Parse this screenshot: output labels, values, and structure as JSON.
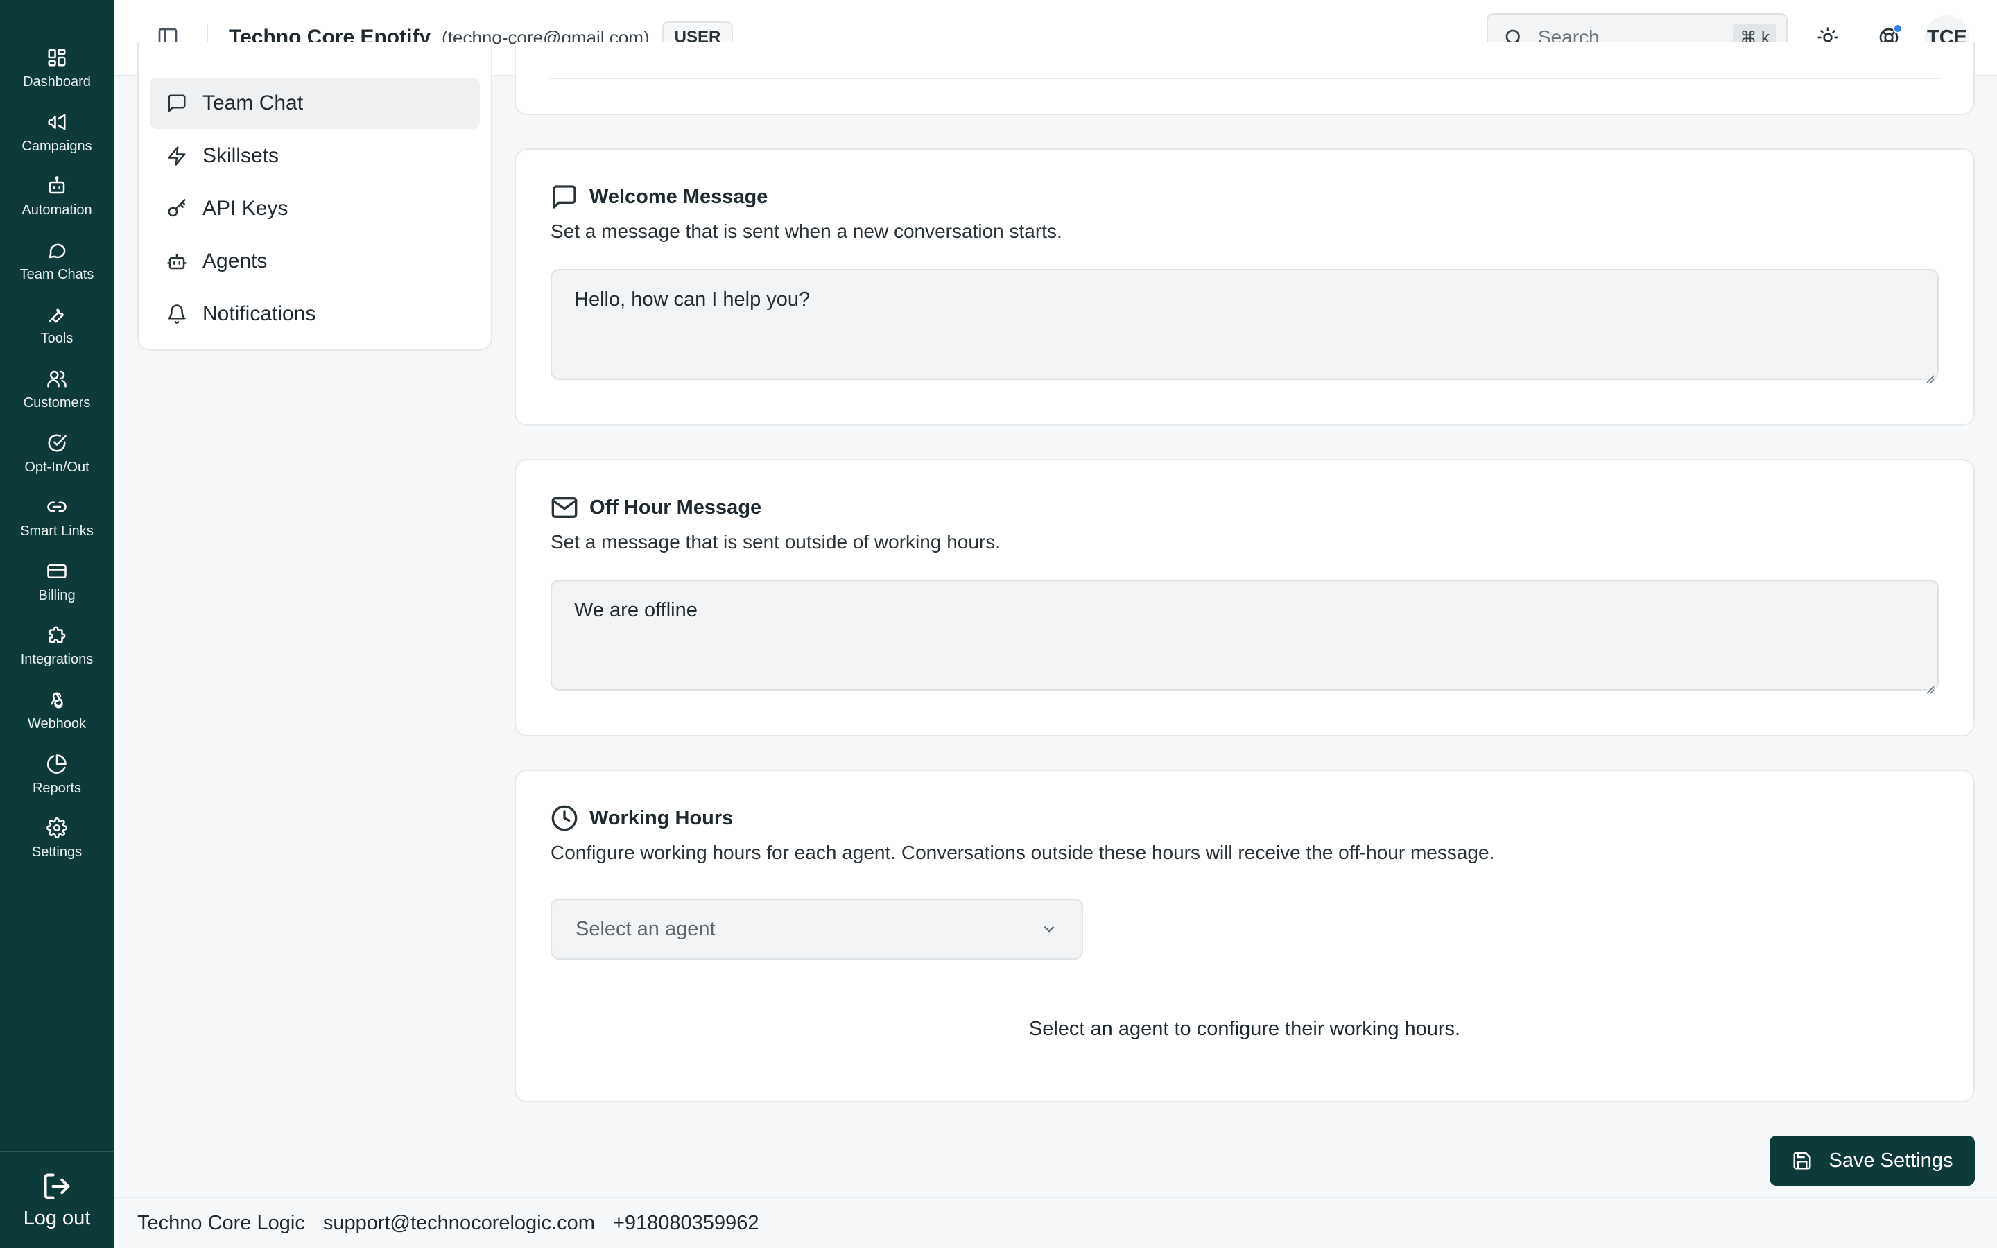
{
  "rail": {
    "items": [
      {
        "label": "Dashboard",
        "icon": "dashboard-icon"
      },
      {
        "label": "Campaigns",
        "icon": "megaphone-icon"
      },
      {
        "label": "Automation",
        "icon": "bot-icon"
      },
      {
        "label": "Team Chats",
        "icon": "chat-icon"
      },
      {
        "label": "Tools",
        "icon": "wrench-icon"
      },
      {
        "label": "Customers",
        "icon": "users-icon"
      },
      {
        "label": "Opt-In/Out",
        "icon": "check-circle-icon"
      },
      {
        "label": "Smart Links",
        "icon": "link-icon"
      },
      {
        "label": "Billing",
        "icon": "credit-card-icon"
      },
      {
        "label": "Integrations",
        "icon": "puzzle-icon"
      },
      {
        "label": "Webhook",
        "icon": "webhook-icon"
      },
      {
        "label": "Reports",
        "icon": "pie-chart-icon"
      },
      {
        "label": "Settings",
        "icon": "gear-icon"
      }
    ],
    "logout_label": "Log out"
  },
  "header": {
    "org_name": "Techno Core Enotify",
    "org_email": "(techno-core@gmail.com)",
    "role": "USER",
    "search_placeholder": "Search...",
    "search_shortcut": "⌘ k",
    "avatar_initials": "TCE"
  },
  "settings_menu": {
    "items": [
      {
        "label": "Team Chat",
        "icon": "message-square-icon",
        "active": true
      },
      {
        "label": "Skillsets",
        "icon": "lightning-icon",
        "active": false
      },
      {
        "label": "API Keys",
        "icon": "key-icon",
        "active": false
      },
      {
        "label": "Agents",
        "icon": "bot-icon",
        "active": false
      },
      {
        "label": "Notifications",
        "icon": "bell-icon",
        "active": false
      }
    ]
  },
  "welcome": {
    "title": "Welcome Message",
    "description": "Set a message that is sent when a new conversation starts.",
    "value": "Hello, how can I help you?"
  },
  "offhour": {
    "title": "Off Hour Message",
    "description": "Set a message that is sent outside of working hours.",
    "value": "We are offline"
  },
  "working_hours": {
    "title": "Working Hours",
    "description": "Configure working hours for each agent. Conversations outside these hours will receive the off-hour message.",
    "select_placeholder": "Select an agent",
    "hint": "Select an agent to configure their working hours."
  },
  "save_label": "Save Settings",
  "footer": {
    "company": "Techno Core Logic",
    "email": "support@technocorelogic.com",
    "phone": "+918080359962"
  },
  "colors": {
    "rail_bg": "#0d3b3a",
    "primary_button": "#0d3b3a",
    "notification_dot": "#2f7ff0"
  }
}
